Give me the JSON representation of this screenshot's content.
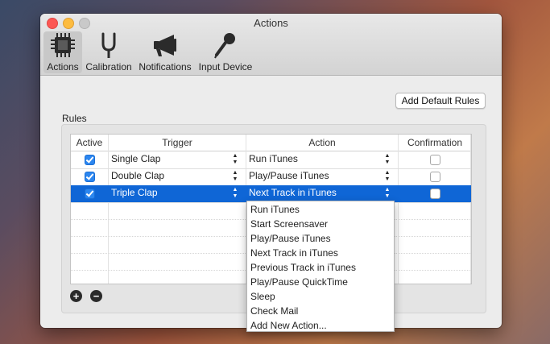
{
  "window": {
    "title": "Actions"
  },
  "toolbar": {
    "items": [
      {
        "label": "Actions",
        "icon": "chip-icon",
        "selected": true
      },
      {
        "label": "Calibration",
        "icon": "tuning-fork-icon",
        "selected": false
      },
      {
        "label": "Notifications",
        "icon": "megaphone-icon",
        "selected": false
      },
      {
        "label": "Input Device",
        "icon": "microphone-icon",
        "selected": false
      }
    ]
  },
  "buttons": {
    "add_default_rules": "Add Default Rules",
    "add": "+",
    "remove": "−"
  },
  "rules": {
    "group_label": "Rules",
    "columns": [
      "Active",
      "Trigger",
      "Action",
      "Confirmation"
    ],
    "rows": [
      {
        "active": true,
        "trigger": "Single Clap",
        "action": "Run iTunes",
        "confirmation": false,
        "selected": false
      },
      {
        "active": true,
        "trigger": "Double Clap",
        "action": "Play/Pause iTunes",
        "confirmation": false,
        "selected": false
      },
      {
        "active": true,
        "trigger": "Triple Clap",
        "action": "Next Track in iTunes",
        "confirmation": false,
        "selected": true
      }
    ]
  },
  "action_menu": {
    "options": [
      "Run iTunes",
      "Start Screensaver",
      "Play/Pause iTunes",
      "Next Track in iTunes",
      "Previous Track in iTunes",
      "Play/Pause QuickTime",
      "Sleep",
      "Check Mail",
      "Add New Action..."
    ]
  },
  "colors": {
    "selection": "#0f66d6",
    "checkbox_on": "#2c86ef",
    "close": "#fc5753",
    "minimize": "#fdbc40"
  }
}
